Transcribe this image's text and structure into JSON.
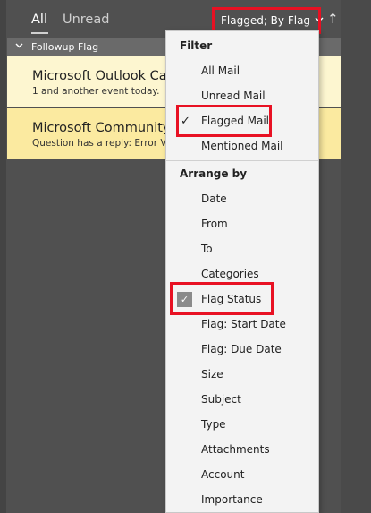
{
  "tabs": [
    {
      "label": "All",
      "active": true
    },
    {
      "label": "Unread",
      "active": false
    }
  ],
  "sort_button": {
    "label": "Flagged; By Flag",
    "chevron_icon": "chevron-down-icon"
  },
  "sort_direction": {
    "icon": "arrow-up-icon",
    "glyph": "↑"
  },
  "group": {
    "label": "Followup Flag",
    "chevron_icon": "chevron-down-icon"
  },
  "messages": [
    {
      "sender": "Microsoft Outlook Calendar",
      "preview": "1 and another event today."
    },
    {
      "sender": "Microsoft Community",
      "preview": "Question has a reply: Error  V"
    }
  ],
  "menu": {
    "filter_header": "Filter",
    "filter_items": [
      {
        "label": "All Mail",
        "checked": false
      },
      {
        "label": "Unread Mail",
        "checked": false
      },
      {
        "label": "Flagged Mail",
        "checked": true
      },
      {
        "label": "Mentioned Mail",
        "checked": false
      }
    ],
    "arrange_header": "Arrange by",
    "arrange_items": [
      {
        "label": "Date",
        "checked": false
      },
      {
        "label": "From",
        "checked": false
      },
      {
        "label": "To",
        "checked": false
      },
      {
        "label": "Categories",
        "checked": false
      },
      {
        "label": "Flag Status",
        "checked": true
      },
      {
        "label": "Flag: Start Date",
        "checked": false
      },
      {
        "label": "Flag: Due Date",
        "checked": false
      },
      {
        "label": "Size",
        "checked": false
      },
      {
        "label": "Subject",
        "checked": false
      },
      {
        "label": "Type",
        "checked": false
      },
      {
        "label": "Attachments",
        "checked": false
      },
      {
        "label": "Account",
        "checked": false
      },
      {
        "label": "Importance",
        "checked": false
      }
    ],
    "check_glyph": "✓"
  },
  "colors": {
    "highlight_box": "#e81123",
    "background": "#505050",
    "menu_background": "#f3f3f3",
    "selected_row": "#fbeaa0",
    "row": "#fdf6d0"
  }
}
